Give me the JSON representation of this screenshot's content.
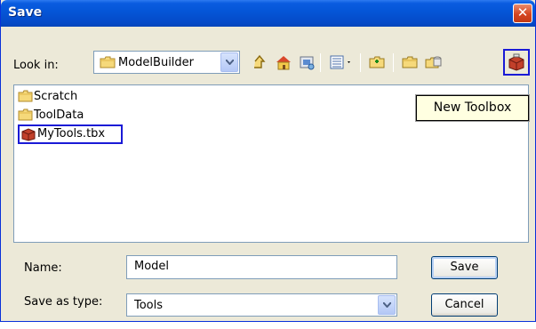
{
  "window": {
    "title": "Save",
    "close_glyph": "✕"
  },
  "toolbar": {
    "lookin_label": "Look in:",
    "lookin_value": "ModelBuilder",
    "icons": [
      "up-one-level-icon",
      "home-icon",
      "connect-folder-icon",
      "view-menu-icon",
      "new-folder-icon",
      "folder-icon",
      "new-geodatabase-icon",
      "new-toolbox-icon"
    ]
  },
  "files": [
    {
      "label": "Scratch",
      "icon": "folder-icon"
    },
    {
      "label": "ToolData",
      "icon": "folder-icon"
    },
    {
      "label": "MyTools.tbx",
      "icon": "toolbox-icon",
      "highlighted": true
    }
  ],
  "tooltip": "New Toolbox",
  "form": {
    "name_label": "Name:",
    "name_value": "Model",
    "type_label": "Save as type:",
    "type_value": "Tools"
  },
  "buttons": {
    "save": "Save",
    "cancel": "Cancel"
  },
  "colors": {
    "titlebar": "#0556d8",
    "highlight_border": "#1a1ad6",
    "tooltip_bg": "#ffffe1",
    "dialog_bg": "#ece9d8"
  }
}
